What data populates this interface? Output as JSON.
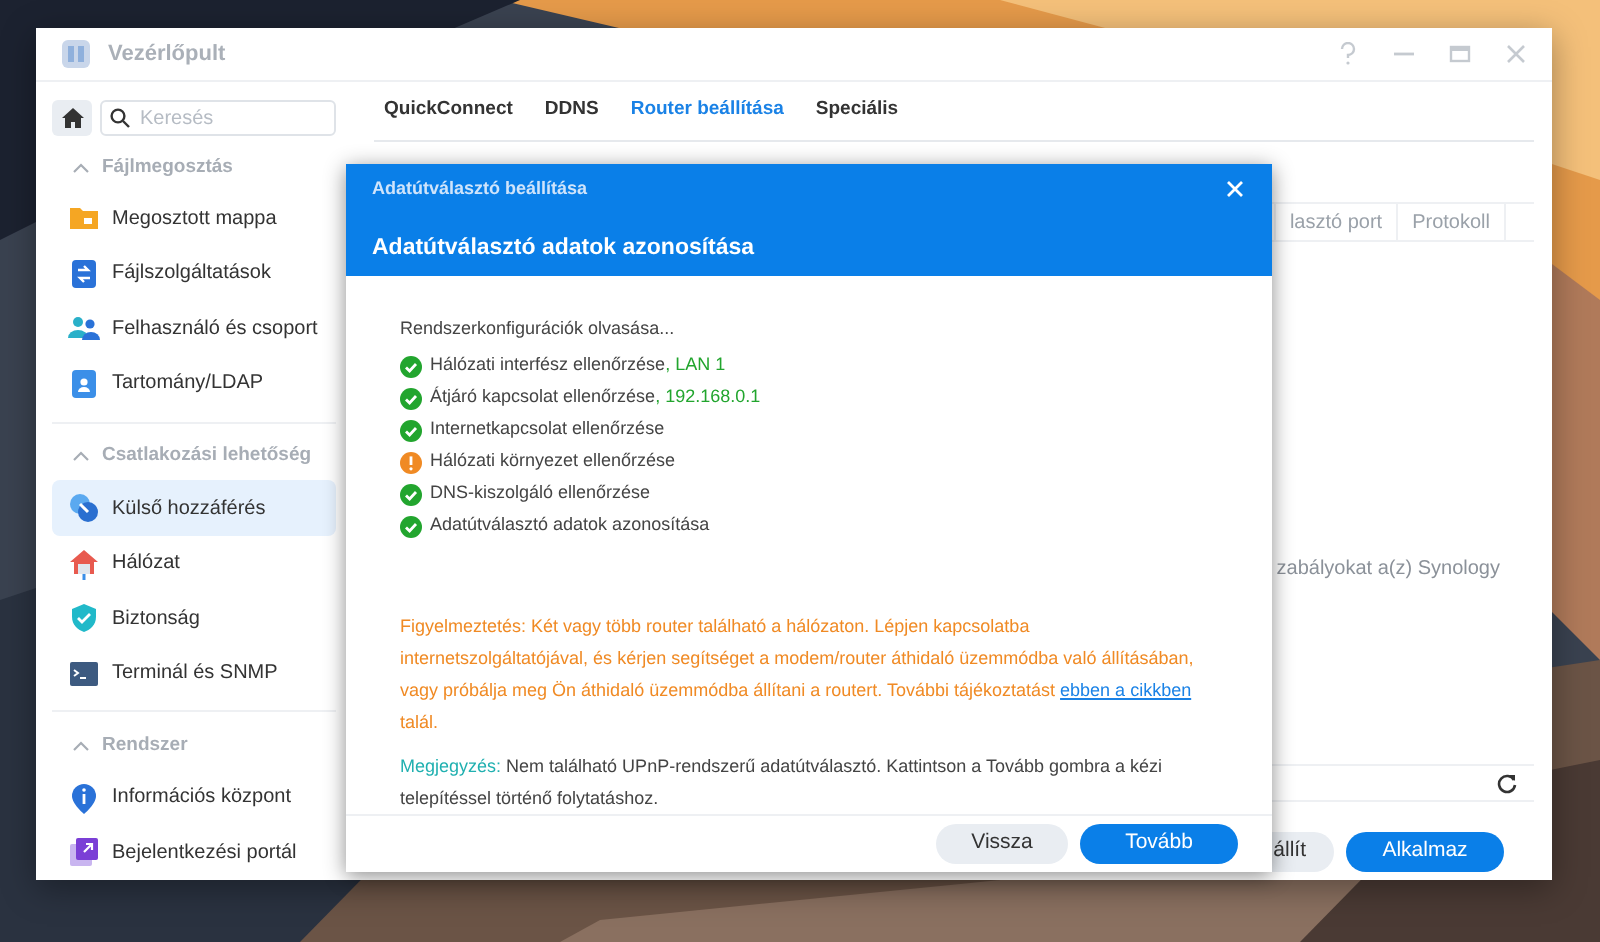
{
  "window": {
    "title": "Vezérlőpult"
  },
  "sidebar": {
    "search": {
      "placeholder": "Keresés"
    },
    "sections": [
      {
        "title": "Fájlmegosztás",
        "expanded": true,
        "items": [
          {
            "label": "Megosztott mappa",
            "selected": false
          },
          {
            "label": "Fájlszolgáltatások",
            "selected": false
          },
          {
            "label": "Felhasználó és csoport",
            "selected": false
          },
          {
            "label": "Tartomány/LDAP",
            "selected": false
          }
        ]
      },
      {
        "title": "Csatlakozási lehetőség",
        "expanded": true,
        "items": [
          {
            "label": "Külső hozzáférés",
            "selected": true
          },
          {
            "label": "Hálózat",
            "selected": false
          },
          {
            "label": "Biztonság",
            "selected": false
          },
          {
            "label": "Terminál és SNMP",
            "selected": false
          }
        ]
      },
      {
        "title": "Rendszer",
        "expanded": true,
        "items": [
          {
            "label": "Információs központ",
            "selected": false
          },
          {
            "label": "Bejelentkezési portál",
            "selected": false
          }
        ]
      }
    ]
  },
  "tabs": [
    {
      "label": "QuickConnect",
      "selected": false
    },
    {
      "label": "DDNS",
      "selected": false
    },
    {
      "label": "Router beállítása",
      "selected": true
    },
    {
      "label": "Speciális",
      "selected": false
    }
  ],
  "table": {
    "columns": [
      "lasztó port",
      "Protokoll"
    ]
  },
  "background_text": "zabályokat a(z) Synology",
  "buttons": [
    {
      "label": "állít",
      "primary": false
    },
    {
      "label": "Alkalmaz",
      "primary": true
    }
  ],
  "dialog": {
    "title": "Adatútválasztó beállítása",
    "heading": "Adatútválasztó adatok azonosítása",
    "intro": "Rendszerkonfigurációk olvasása...",
    "checks": [
      {
        "text": "Hálózati interfész ellenőrzése",
        "detail": ", LAN 1",
        "warning": false
      },
      {
        "text": "Átjáró kapcsolat ellenőrzése",
        "detail": ", 192.168.0.1",
        "warning": false
      },
      {
        "text": "Internetkapcsolat ellenőrzése",
        "warning": false
      },
      {
        "text": "Hálózati környezet ellenőrzése",
        "warning": true
      },
      {
        "text": "DNS-kiszolgáló ellenőrzése",
        "warning": false
      },
      {
        "text": "Adatútválasztó adatok azonosítása",
        "warning": false
      }
    ],
    "warning": {
      "text": "Figyelmeztetés: Két vagy több router található a hálózaton. Lépjen kapcsolatba internetszolgáltatójával, és kérjen segítséget a modem/router áthidaló üzemmódba való állításában, vagy próbálja meg Ön áthidaló üzemmódba állítani a routert. További tájékoztatást",
      "link": "ebben a cikkben",
      "after": " talál."
    },
    "note": {
      "label": "Megjegyzés:",
      "text": " Nem található UPnP-rendszerű adatútválasztó. Kattintson a Tovább gombra a kézi telepítéssel történő folytatáshoz."
    },
    "buttons": [
      {
        "label": "Vissza",
        "primary": false
      },
      {
        "label": "Tovább",
        "primary": true
      }
    ]
  }
}
